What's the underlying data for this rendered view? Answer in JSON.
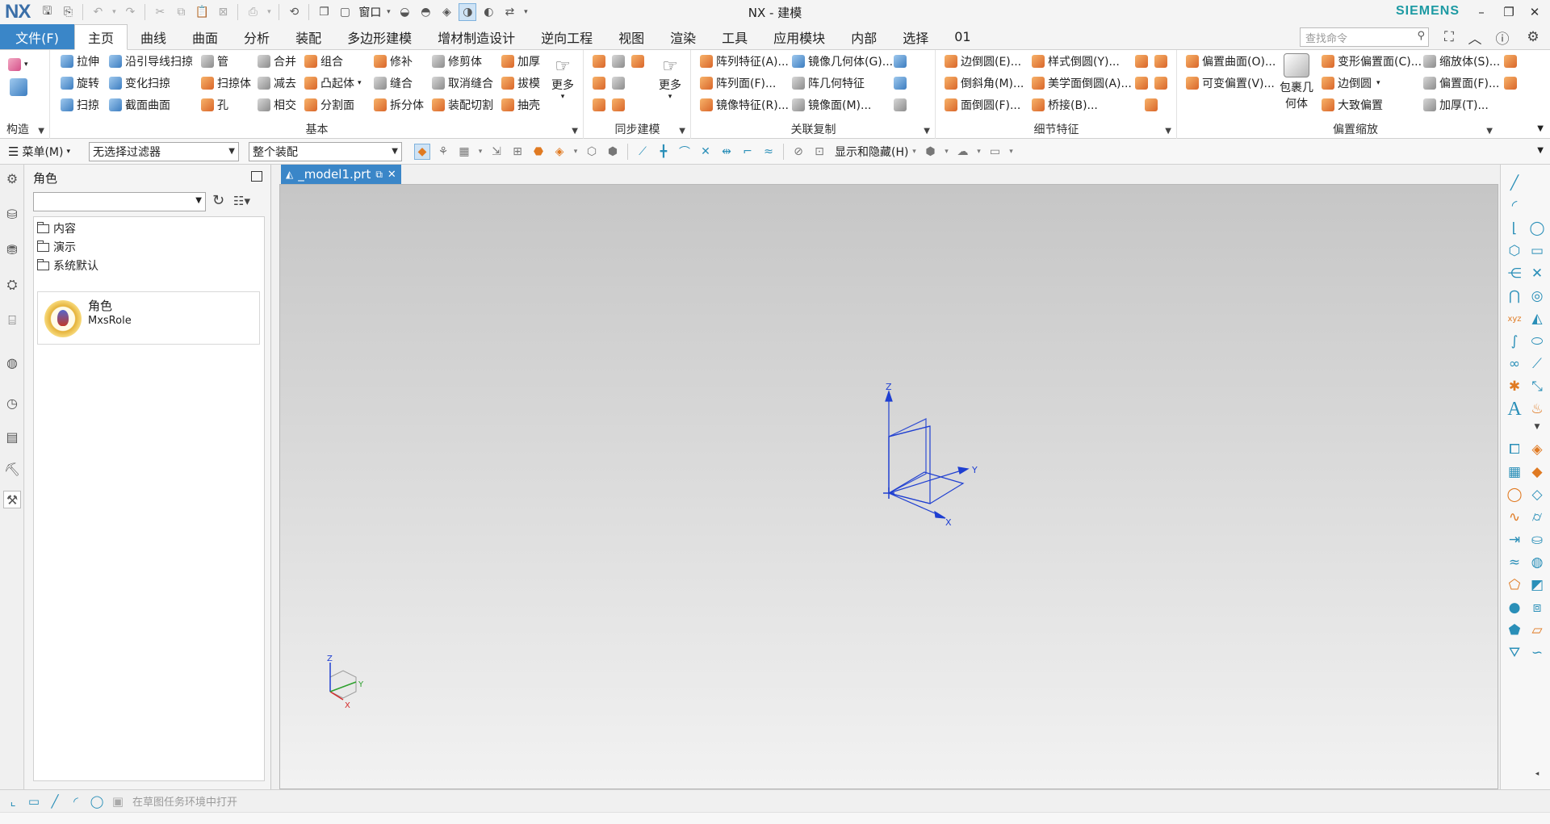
{
  "app": {
    "logo": "NX",
    "window_title": "NX - 建模",
    "brand": "SIEMENS",
    "window_menu_label": "窗口"
  },
  "ribbon_tabs": [
    "文件(F)",
    "主页",
    "曲线",
    "曲面",
    "分析",
    "装配",
    "多边形建模",
    "增材制造设计",
    "逆向工程",
    "视图",
    "渲染",
    "工具",
    "应用模块",
    "内部",
    "选择",
    "01"
  ],
  "command_search": {
    "placeholder": "查找命令"
  },
  "ribbon_groups": {
    "construct": {
      "label": "构造"
    },
    "basic": {
      "label": "基本",
      "more": "更多",
      "items": [
        "拉伸",
        "沿引导线扫掠",
        "管",
        "合并",
        "组合",
        "修补",
        "修剪体",
        "加厚",
        "旋转",
        "变化扫掠",
        "扫掠体",
        "减去",
        "凸起体",
        "缝合",
        "取消缝合",
        "拔模",
        "扫掠",
        "截面曲面",
        "孔",
        "相交",
        "分割面",
        "拆分体",
        "装配切割",
        "抽壳"
      ]
    },
    "sync": {
      "label": "同步建模",
      "more": "更多"
    },
    "assoc_copy": {
      "label": "关联复制",
      "items": [
        "阵列特征(A)...",
        "镜像几何体(G)...",
        "阵列面(F)...",
        "阵几何特征",
        "镜像特征(R)...",
        "镜像面(M)..."
      ]
    },
    "detail": {
      "label": "细节特征",
      "items": [
        "边倒圆(E)...",
        "样式倒圆(Y)...",
        "倒斜角(M)...",
        "美学面倒圆(A)...",
        "面倒圆(F)...",
        "桥接(B)..."
      ]
    },
    "offset_scale": {
      "label": "偏置缩放",
      "items": [
        "偏置曲面(O)...",
        "变形偏置面(C)...",
        "缩放体(S)...",
        "可变偏置(V)...",
        "边倒圆",
        "偏置面(F)...",
        "大致偏置",
        "加厚(T)..."
      ],
      "wrap_label_1": "包裹几",
      "wrap_label_2": "何体"
    }
  },
  "selection_bar": {
    "menu_label": "菜单(M)",
    "filter": "无选择过滤器",
    "scope": "整个装配",
    "show_hide": "显示和隐藏(H)"
  },
  "navigator": {
    "title": "角色",
    "folders": [
      "内容",
      "演示",
      "系统默认"
    ],
    "role_card": {
      "name": "角色",
      "sub": "MxsRole"
    }
  },
  "document_tab": {
    "label": "_model1.prt"
  },
  "datum": {
    "x_label": "X",
    "y_label": "Y",
    "z_label": "Z"
  },
  "triad": {
    "x_label": "X",
    "y_label": "Y",
    "z_label": "Z"
  },
  "status_bar": {
    "message": "在草图任务环境中打开"
  },
  "colors": {
    "accent": "#3a86c8",
    "brand": "#1d9aa3",
    "datum": "#1f3fd1",
    "icon_teal": "#2a8fb8"
  }
}
